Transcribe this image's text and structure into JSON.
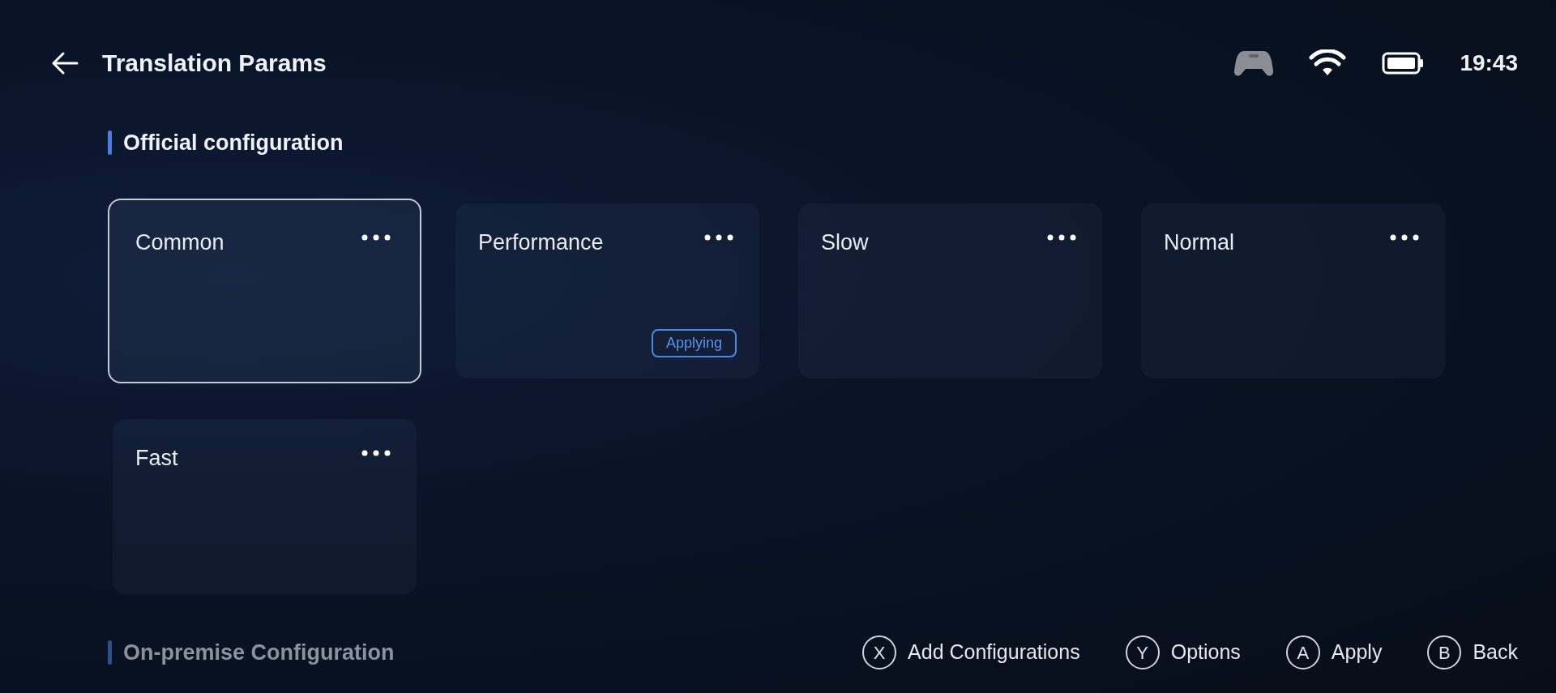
{
  "header": {
    "title": "Translation Params",
    "time": "19:43"
  },
  "sections": [
    {
      "title": "Official configuration",
      "active": true,
      "cards": [
        {
          "name": "Common",
          "selected": true
        },
        {
          "name": "Performance",
          "selected": false,
          "badge": "Applying"
        },
        {
          "name": "Slow",
          "selected": false
        },
        {
          "name": "Normal",
          "selected": false
        },
        {
          "name": "Fast",
          "selected": false
        }
      ]
    },
    {
      "title": "On-premise Configuration",
      "active": false
    }
  ],
  "hints": [
    {
      "key": "X",
      "label": "Add Configurations"
    },
    {
      "key": "Y",
      "label": "Options"
    },
    {
      "key": "A",
      "label": "Apply"
    },
    {
      "key": "B",
      "label": "Back"
    }
  ]
}
